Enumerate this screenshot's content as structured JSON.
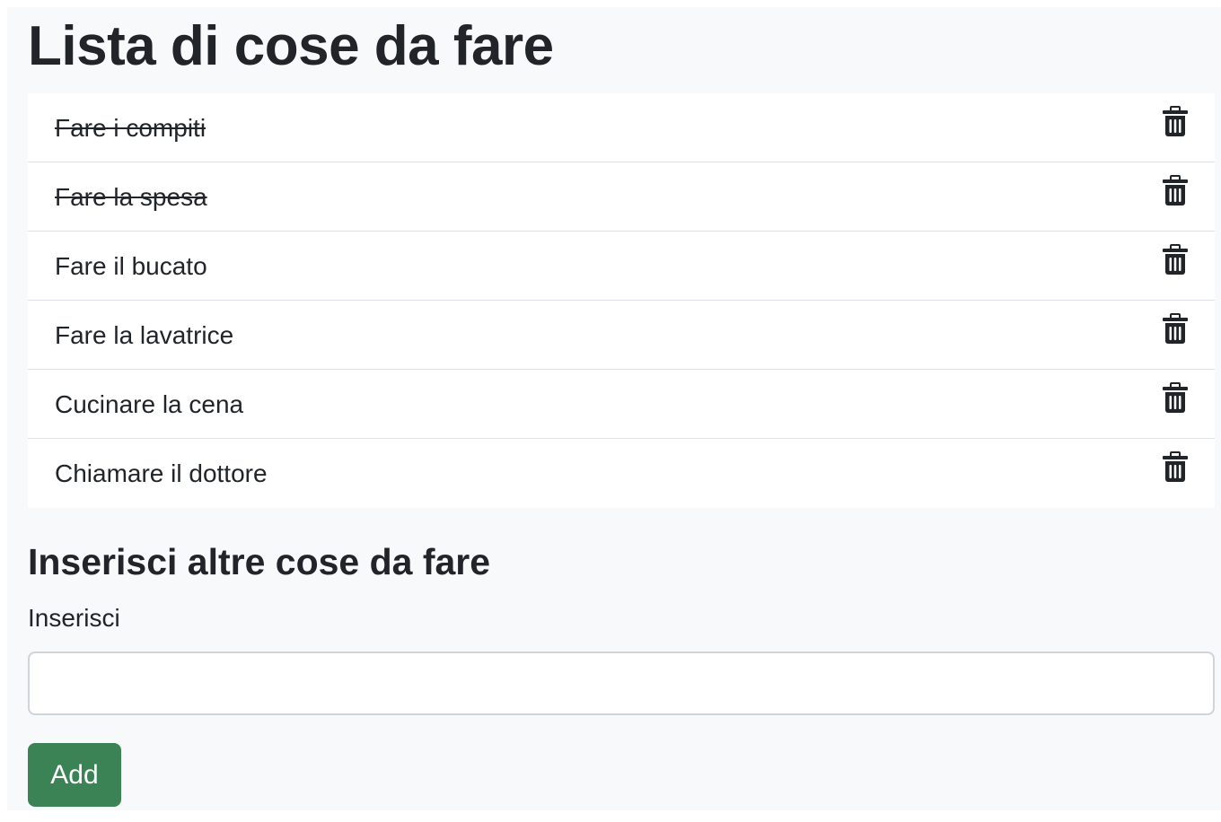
{
  "page": {
    "title": "Lista di cose da fare"
  },
  "todos": [
    {
      "text": "Fare i compiti",
      "done": true,
      "delete_icon": "trash-icon"
    },
    {
      "text": "Fare la spesa",
      "done": true,
      "delete_icon": "trash-icon"
    },
    {
      "text": "Fare il bucato",
      "done": false,
      "delete_icon": "trash-icon"
    },
    {
      "text": "Fare la lavatrice",
      "done": false,
      "delete_icon": "trash-icon"
    },
    {
      "text": "Cucinare la cena",
      "done": false,
      "delete_icon": "trash-icon"
    },
    {
      "text": "Chiamare il dottore",
      "done": false,
      "delete_icon": "trash-icon"
    }
  ],
  "form": {
    "heading": "Inserisci altre cose da fare",
    "label": "Inserisci",
    "input_value": "",
    "input_placeholder": "",
    "submit_label": "Add"
  },
  "colors": {
    "background": "#f8f9fa",
    "text": "#212529",
    "button": "#3b8355",
    "border": "#dee2e6"
  }
}
